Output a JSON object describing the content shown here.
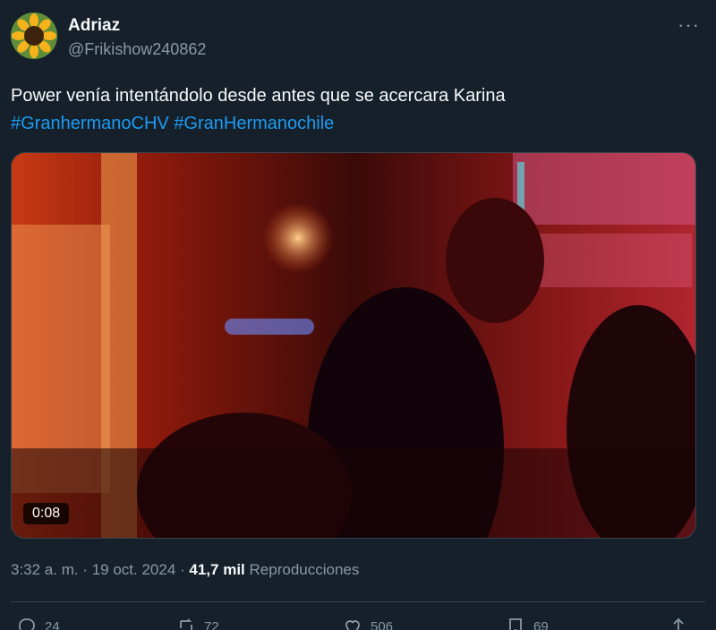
{
  "author": {
    "display_name": "Adriaz",
    "handle": "@Frikishow240862",
    "avatar_icon": "sunflower-avatar"
  },
  "tweet": {
    "text": "Power venía intentándolo desde antes que se acercara Karina",
    "hashtags": [
      "#GranhermanoCHV",
      "#GranHermanochile"
    ]
  },
  "media": {
    "duration": "0:08",
    "description_icon": "video-thumbnail"
  },
  "meta": {
    "time": "3:32 a. m.",
    "separator": " · ",
    "date": "19 oct. 2024",
    "views": "41,7 mil",
    "views_label": "Reproducciones"
  },
  "actions": {
    "reply_count": "24",
    "retweet_count": "72",
    "like_count": "506",
    "bookmark_count": "69"
  },
  "colors": {
    "background": "#15202b",
    "text": "#f7f9f9",
    "secondary": "#8b98a5",
    "link": "#1d9bf0",
    "border": "#38444d"
  }
}
